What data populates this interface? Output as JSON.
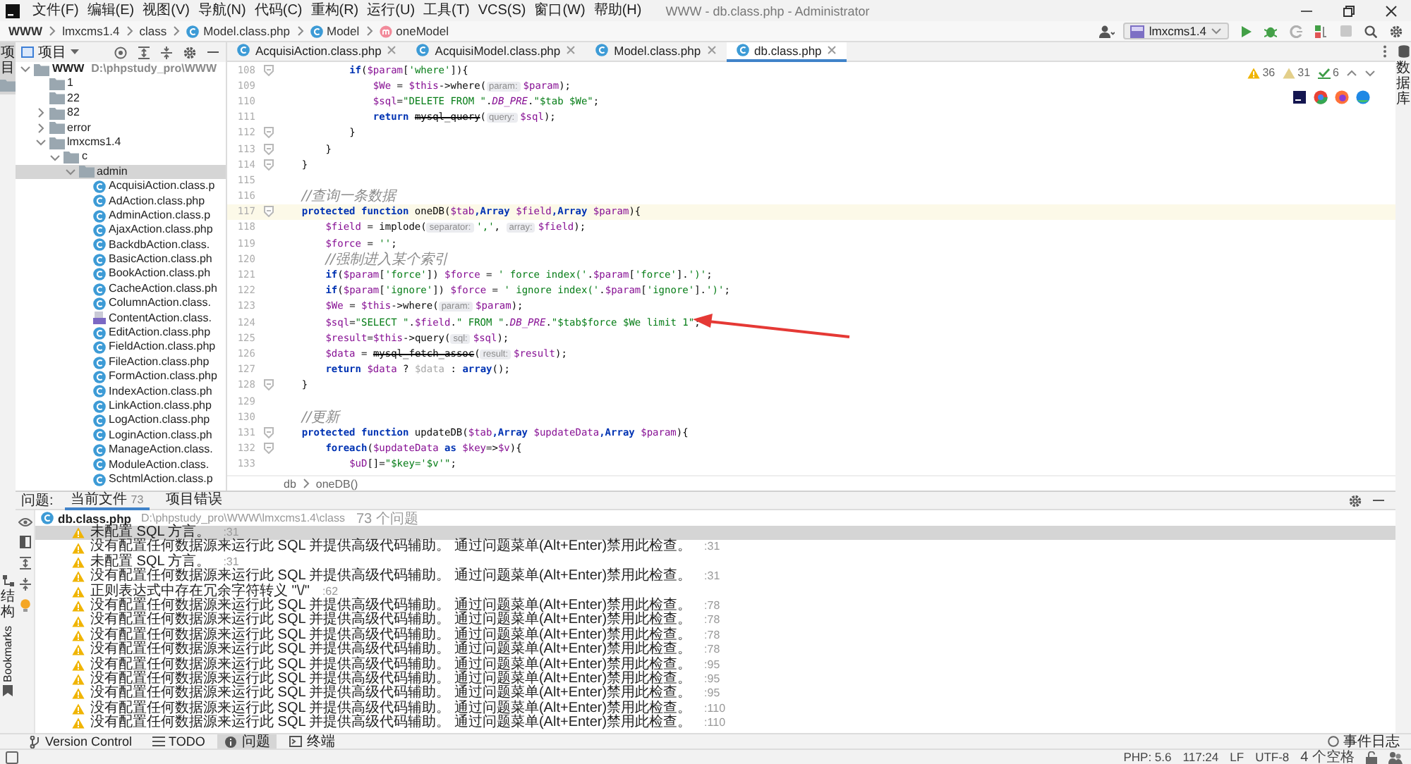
{
  "window": {
    "title": "WWW - db.class.php - Administrator"
  },
  "menu": [
    "文件(F)",
    "编辑(E)",
    "视图(V)",
    "导航(N)",
    "代码(C)",
    "重构(R)",
    "运行(U)",
    "工具(T)",
    "VCS(S)",
    "窗口(W)",
    "帮助(H)"
  ],
  "breadcrumbs": [
    {
      "kind": "project",
      "text": "WWW"
    },
    {
      "kind": "folder",
      "text": "lmxcms1.4"
    },
    {
      "kind": "folder",
      "text": "class"
    },
    {
      "kind": "class-file",
      "text": "Model.class.php"
    },
    {
      "kind": "class",
      "text": "Model"
    },
    {
      "kind": "method",
      "text": "oneModel"
    }
  ],
  "run_config": {
    "label": "lmxcms1.4"
  },
  "left_strip": {
    "top": [
      {
        "label": "项目",
        "kind": "stacked",
        "selected": true
      }
    ],
    "bottom": [
      {
        "label": "结构",
        "kind": "stacked",
        "selected": false
      },
      {
        "label": "Bookmarks",
        "kind": "rotated",
        "selected": false
      }
    ]
  },
  "right_strip": {
    "top": [
      {
        "label": "数据库",
        "kind": "stacked",
        "selected": false
      }
    ]
  },
  "project_panel": {
    "title": "项目",
    "tree": [
      {
        "label": "WWW",
        "path": "D:\\phpstudy_pro\\WWW",
        "kind": "root",
        "expanded": true,
        "selected": false,
        "children": [
          {
            "label": "1",
            "kind": "plain-folder",
            "selected": false
          },
          {
            "label": "22",
            "kind": "plain-folder",
            "selected": false
          },
          {
            "label": "82",
            "kind": "folder",
            "expanded": false,
            "selected": false
          },
          {
            "label": "error",
            "kind": "folder",
            "expanded": false,
            "selected": false
          },
          {
            "label": "lmxcms1.4",
            "kind": "folder",
            "expanded": true,
            "selected": false,
            "children": [
              {
                "label": "c",
                "kind": "folder",
                "expanded": true,
                "selected": false,
                "children": [
                  {
                    "label": "admin",
                    "kind": "folder",
                    "expanded": true,
                    "selected": true,
                    "children": [
                      {
                        "label": "AcquisiAction.class.p",
                        "kind": "class-file",
                        "selected": false
                      },
                      {
                        "label": "AdAction.class.php",
                        "kind": "class-file",
                        "selected": false
                      },
                      {
                        "label": "AdminAction.class.p",
                        "kind": "class-file",
                        "selected": false
                      },
                      {
                        "label": "AjaxAction.class.php",
                        "kind": "class-file",
                        "selected": false
                      },
                      {
                        "label": "BackdbAction.class.",
                        "kind": "class-file",
                        "selected": false
                      },
                      {
                        "label": "BasicAction.class.ph",
                        "kind": "class-file",
                        "selected": false
                      },
                      {
                        "label": "BookAction.class.ph",
                        "kind": "class-file",
                        "selected": false
                      },
                      {
                        "label": "CacheAction.class.ph",
                        "kind": "class-file",
                        "selected": false
                      },
                      {
                        "label": "ColumnAction.class.",
                        "kind": "class-file",
                        "selected": false
                      },
                      {
                        "label": "ContentAction.class.",
                        "kind": "php-file",
                        "selected": false
                      },
                      {
                        "label": "EditAction.class.php",
                        "kind": "class-file",
                        "selected": false
                      },
                      {
                        "label": "FieldAction.class.php",
                        "kind": "class-file",
                        "selected": false
                      },
                      {
                        "label": "FileAction.class.php",
                        "kind": "class-file",
                        "selected": false
                      },
                      {
                        "label": "FormAction.class.php",
                        "kind": "class-file",
                        "selected": false
                      },
                      {
                        "label": "IndexAction.class.ph",
                        "kind": "class-file",
                        "selected": false
                      },
                      {
                        "label": "LinkAction.class.php",
                        "kind": "class-file",
                        "selected": false
                      },
                      {
                        "label": "LogAction.class.php",
                        "kind": "class-file",
                        "selected": false
                      },
                      {
                        "label": "LoginAction.class.ph",
                        "kind": "class-file",
                        "selected": false
                      },
                      {
                        "label": "ManageAction.class.",
                        "kind": "class-file",
                        "selected": false
                      },
                      {
                        "label": "ModuleAction.class.",
                        "kind": "class-file",
                        "selected": false
                      },
                      {
                        "label": "SchtmlAction.class.p",
                        "kind": "class-file",
                        "selected": false
                      }
                    ]
                  }
                ]
              }
            ]
          }
        ]
      }
    ]
  },
  "editor": {
    "tabs": [
      {
        "label": "AcquisiAction.class.php",
        "selected": false
      },
      {
        "label": "AcquisiModel.class.php",
        "selected": false
      },
      {
        "label": "Model.class.php",
        "selected": false
      },
      {
        "label": "db.class.php",
        "selected": true
      }
    ],
    "inspections": [
      {
        "kind": "warning",
        "count": "36"
      },
      {
        "kind": "weak-warning",
        "count": "31"
      },
      {
        "kind": "check",
        "count": "6"
      }
    ],
    "lines": [
      {
        "number": "108",
        "fold": true,
        "current": false,
        "tokens": [
          {
            "kind": "keyword",
            "text": "if"
          },
          {
            "kind": "plain",
            "text": "("
          },
          {
            "kind": "var",
            "text": "$param"
          },
          {
            "kind": "plain",
            "text": "["
          },
          {
            "kind": "string",
            "text": "'where'"
          },
          {
            "kind": "plain",
            "text": "]){"
          }
        ]
      },
      {
        "number": "109",
        "fold": false,
        "current": false,
        "tokens": [
          {
            "kind": "var",
            "text": "$We"
          },
          {
            "kind": "plain",
            "text": " = "
          },
          {
            "kind": "var",
            "text": "$this"
          },
          {
            "kind": "plain",
            "text": "->where("
          },
          {
            "kind": "hint",
            "text": "param:"
          },
          {
            "kind": "var",
            "text": "$param"
          },
          {
            "kind": "plain",
            "text": ");"
          }
        ]
      },
      {
        "number": "110",
        "fold": false,
        "current": false,
        "tokens": [
          {
            "kind": "var",
            "text": "$sql"
          },
          {
            "kind": "plain",
            "text": "="
          },
          {
            "kind": "string",
            "text": "\"DELETE FROM \""
          },
          {
            "kind": "plain",
            "text": "."
          },
          {
            "kind": "const",
            "text": "DB_PRE"
          },
          {
            "kind": "plain",
            "text": "."
          },
          {
            "kind": "string",
            "text": "\"$tab $We\""
          },
          {
            "kind": "plain",
            "text": ";"
          }
        ]
      },
      {
        "number": "111",
        "fold": false,
        "current": false,
        "tokens": [
          {
            "kind": "keyword",
            "text": "return "
          },
          {
            "kind": "deprecated",
            "text": "mysql_query"
          },
          {
            "kind": "plain",
            "text": "("
          },
          {
            "kind": "hint",
            "text": "query:"
          },
          {
            "kind": "var",
            "text": "$sql"
          },
          {
            "kind": "plain",
            "text": ");"
          }
        ]
      },
      {
        "number": "112",
        "fold": true,
        "current": false,
        "tokens": [
          {
            "kind": "plain",
            "text": "}"
          }
        ]
      },
      {
        "number": "113",
        "fold": true,
        "current": false,
        "tokens": [
          {
            "kind": "plain",
            "text": "}"
          }
        ]
      },
      {
        "number": "114",
        "fold": true,
        "current": false,
        "tokens": [
          {
            "kind": "plain",
            "text": "}"
          }
        ]
      },
      {
        "number": "115",
        "fold": false,
        "current": false
      },
      {
        "number": "116",
        "fold": false,
        "current": false,
        "tokens": [
          {
            "kind": "comment",
            "text": "//查询一条数据"
          }
        ]
      },
      {
        "number": "117",
        "fold": true,
        "current": true,
        "tokens": [
          {
            "kind": "keyword",
            "text": "protected function "
          },
          {
            "kind": "plain",
            "text": "oneDB("
          },
          {
            "kind": "var",
            "text": "$tab"
          },
          {
            "kind": "keyword",
            "text": ",Array "
          },
          {
            "kind": "var",
            "text": "$field"
          },
          {
            "kind": "keyword",
            "text": ",Array "
          },
          {
            "kind": "var",
            "text": "$param"
          },
          {
            "kind": "plain",
            "text": "){"
          }
        ]
      },
      {
        "number": "118",
        "fold": false,
        "current": false,
        "tokens": [
          {
            "kind": "var",
            "text": "$field"
          },
          {
            "kind": "plain",
            "text": " = implode("
          },
          {
            "kind": "hint",
            "text": "separator:"
          },
          {
            "kind": "string",
            "text": "','"
          },
          {
            "kind": "plain",
            "text": ", "
          },
          {
            "kind": "hint",
            "text": "array:"
          },
          {
            "kind": "var",
            "text": "$field"
          },
          {
            "kind": "plain",
            "text": ");"
          }
        ]
      },
      {
        "number": "119",
        "fold": false,
        "current": false,
        "tokens": [
          {
            "kind": "var",
            "text": "$force"
          },
          {
            "kind": "plain",
            "text": " = "
          },
          {
            "kind": "string",
            "text": "''"
          },
          {
            "kind": "plain",
            "text": ";"
          }
        ]
      },
      {
        "number": "120",
        "fold": false,
        "current": false,
        "tokens": [
          {
            "kind": "comment",
            "text": "//强制进入某个索引"
          }
        ]
      },
      {
        "number": "121",
        "fold": false,
        "current": false,
        "tokens": [
          {
            "kind": "keyword",
            "text": "if"
          },
          {
            "kind": "plain",
            "text": "("
          },
          {
            "kind": "var",
            "text": "$param"
          },
          {
            "kind": "plain",
            "text": "["
          },
          {
            "kind": "string",
            "text": "'force'"
          },
          {
            "kind": "plain",
            "text": "]) "
          },
          {
            "kind": "var",
            "text": "$force"
          },
          {
            "kind": "plain",
            "text": " = "
          },
          {
            "kind": "string",
            "text": "' force index('"
          },
          {
            "kind": "plain",
            "text": "."
          },
          {
            "kind": "var",
            "text": "$param"
          },
          {
            "kind": "plain",
            "text": "["
          },
          {
            "kind": "string",
            "text": "'force'"
          },
          {
            "kind": "plain",
            "text": "]."
          },
          {
            "kind": "string",
            "text": "')'"
          },
          {
            "kind": "plain",
            "text": ";"
          }
        ]
      },
      {
        "number": "122",
        "fold": false,
        "current": false,
        "tokens": [
          {
            "kind": "keyword",
            "text": "if"
          },
          {
            "kind": "plain",
            "text": "("
          },
          {
            "kind": "var",
            "text": "$param"
          },
          {
            "kind": "plain",
            "text": "["
          },
          {
            "kind": "string",
            "text": "'ignore'"
          },
          {
            "kind": "plain",
            "text": "]) "
          },
          {
            "kind": "var",
            "text": "$force"
          },
          {
            "kind": "plain",
            "text": " = "
          },
          {
            "kind": "string",
            "text": "' ignore index('"
          },
          {
            "kind": "plain",
            "text": "."
          },
          {
            "kind": "var",
            "text": "$param"
          },
          {
            "kind": "plain",
            "text": "["
          },
          {
            "kind": "string",
            "text": "'ignore'"
          },
          {
            "kind": "plain",
            "text": "]."
          },
          {
            "kind": "string",
            "text": "')'"
          },
          {
            "kind": "plain",
            "text": ";"
          }
        ]
      },
      {
        "number": "123",
        "fold": false,
        "current": false,
        "tokens": [
          {
            "kind": "var",
            "text": "$We"
          },
          {
            "kind": "plain",
            "text": " = "
          },
          {
            "kind": "var",
            "text": "$this"
          },
          {
            "kind": "plain",
            "text": "->where("
          },
          {
            "kind": "hint",
            "text": "param:"
          },
          {
            "kind": "var",
            "text": "$param"
          },
          {
            "kind": "plain",
            "text": ");"
          }
        ]
      },
      {
        "number": "124",
        "fold": false,
        "current": false,
        "tokens": [
          {
            "kind": "var",
            "text": "$sql"
          },
          {
            "kind": "plain",
            "text": "="
          },
          {
            "kind": "string",
            "text": "\"SELECT \""
          },
          {
            "kind": "plain",
            "text": "."
          },
          {
            "kind": "var",
            "text": "$field"
          },
          {
            "kind": "plain",
            "text": "."
          },
          {
            "kind": "string",
            "text": "\" FROM \""
          },
          {
            "kind": "plain",
            "text": "."
          },
          {
            "kind": "const",
            "text": "DB_PRE"
          },
          {
            "kind": "plain",
            "text": "."
          },
          {
            "kind": "string",
            "text": "\"$tab$force $We limit 1\""
          },
          {
            "kind": "plain",
            "text": ";"
          }
        ]
      },
      {
        "number": "125",
        "fold": false,
        "current": false,
        "tokens": [
          {
            "kind": "var",
            "text": "$result"
          },
          {
            "kind": "plain",
            "text": "="
          },
          {
            "kind": "var",
            "text": "$this"
          },
          {
            "kind": "plain",
            "text": "->query("
          },
          {
            "kind": "hint",
            "text": "sql:"
          },
          {
            "kind": "var",
            "text": "$sql"
          },
          {
            "kind": "plain",
            "text": ");"
          }
        ]
      },
      {
        "number": "126",
        "fold": false,
        "current": false,
        "tokens": [
          {
            "kind": "var",
            "text": "$data"
          },
          {
            "kind": "plain",
            "text": " = "
          },
          {
            "kind": "deprecated",
            "text": "mysql_fetch_assoc"
          },
          {
            "kind": "plain",
            "text": "("
          },
          {
            "kind": "hint",
            "text": "result:"
          },
          {
            "kind": "var",
            "text": "$result"
          },
          {
            "kind": "plain",
            "text": ");"
          }
        ]
      },
      {
        "number": "127",
        "fold": false,
        "current": false,
        "tokens": [
          {
            "kind": "keyword",
            "text": "return "
          },
          {
            "kind": "var",
            "text": "$data"
          },
          {
            "kind": "plain",
            "text": " ? "
          },
          {
            "kind": "dim",
            "text": "$data"
          },
          {
            "kind": "plain",
            "text": " : "
          },
          {
            "kind": "keyword",
            "text": "array"
          },
          {
            "kind": "plain",
            "text": "();"
          }
        ]
      },
      {
        "number": "128",
        "fold": true,
        "current": false,
        "tokens": [
          {
            "kind": "plain",
            "text": "}"
          }
        ]
      },
      {
        "number": "129",
        "fold": false,
        "current": false
      },
      {
        "number": "130",
        "fold": false,
        "current": false,
        "tokens": [
          {
            "kind": "comment",
            "text": "//更新"
          }
        ]
      },
      {
        "number": "131",
        "fold": true,
        "current": false,
        "tokens": [
          {
            "kind": "keyword",
            "text": "protected function "
          },
          {
            "kind": "plain",
            "text": "updateDB("
          },
          {
            "kind": "var",
            "text": "$tab"
          },
          {
            "kind": "keyword",
            "text": ",Array "
          },
          {
            "kind": "var",
            "text": "$updateData"
          },
          {
            "kind": "keyword",
            "text": ",Array "
          },
          {
            "kind": "var",
            "text": "$param"
          },
          {
            "kind": "plain",
            "text": "){"
          }
        ]
      },
      {
        "number": "132",
        "fold": true,
        "current": false,
        "tokens": [
          {
            "kind": "keyword",
            "text": "foreach"
          },
          {
            "kind": "plain",
            "text": "("
          },
          {
            "kind": "var",
            "text": "$updateData"
          },
          {
            "kind": "keyword",
            "text": " as "
          },
          {
            "kind": "var",
            "text": "$key"
          },
          {
            "kind": "plain",
            "text": "=>"
          },
          {
            "kind": "var",
            "text": "$v"
          },
          {
            "kind": "plain",
            "text": "){"
          }
        ]
      },
      {
        "number": "133",
        "fold": false,
        "current": false,
        "tokens": [
          {
            "kind": "var",
            "text": "$uD"
          },
          {
            "kind": "plain",
            "text": "[]="
          },
          {
            "kind": "string",
            "text": "\"$key='$v'\""
          },
          {
            "kind": "plain",
            "text": ";"
          }
        ]
      }
    ],
    "breadcrumb": [
      "db",
      "oneDB()"
    ]
  },
  "problems": {
    "title": "问题:",
    "tabs": [
      {
        "label": "当前文件",
        "count": "73",
        "selected": true
      },
      {
        "label": "项目错误",
        "selected": false
      }
    ],
    "file": {
      "name": "db.class.php",
      "path": "D:\\phpstudy_pro\\WWW\\lmxcms1.4\\class",
      "count": "73 个问题"
    },
    "items": [
      {
        "message": "未配置 SQL 方言。",
        "line": ":31",
        "selected": true
      },
      {
        "message": "没有配置任何数据源来运行此 SQL 并提供高级代码辅助。 通过问题菜单(Alt+Enter)禁用此检查。",
        "line": ":31",
        "selected": false
      },
      {
        "message": "未配置 SQL 方言。",
        "line": ":31",
        "selected": false
      },
      {
        "message": "没有配置任何数据源来运行此 SQL 并提供高级代码辅助。 通过问题菜单(Alt+Enter)禁用此检查。",
        "line": ":31",
        "selected": false
      },
      {
        "message": "正则表达式中存在冗余字符转义 \"\\/\"",
        "line": ":62",
        "selected": false
      },
      {
        "message": "没有配置任何数据源来运行此 SQL 并提供高级代码辅助。 通过问题菜单(Alt+Enter)禁用此检查。",
        "line": ":78",
        "selected": false
      },
      {
        "message": "没有配置任何数据源来运行此 SQL 并提供高级代码辅助。 通过问题菜单(Alt+Enter)禁用此检查。",
        "line": ":78",
        "selected": false
      },
      {
        "message": "没有配置任何数据源来运行此 SQL 并提供高级代码辅助。 通过问题菜单(Alt+Enter)禁用此检查。",
        "line": ":78",
        "selected": false
      },
      {
        "message": "没有配置任何数据源来运行此 SQL 并提供高级代码辅助。 通过问题菜单(Alt+Enter)禁用此检查。",
        "line": ":78",
        "selected": false
      },
      {
        "message": "没有配置任何数据源来运行此 SQL 并提供高级代码辅助。 通过问题菜单(Alt+Enter)禁用此检查。",
        "line": ":95",
        "selected": false
      },
      {
        "message": "没有配置任何数据源来运行此 SQL 并提供高级代码辅助。 通过问题菜单(Alt+Enter)禁用此检查。",
        "line": ":95",
        "selected": false
      },
      {
        "message": "没有配置任何数据源来运行此 SQL 并提供高级代码辅助。 通过问题菜单(Alt+Enter)禁用此检查。",
        "line": ":95",
        "selected": false
      },
      {
        "message": "没有配置任何数据源来运行此 SQL 并提供高级代码辅助。 通过问题菜单(Alt+Enter)禁用此检查。",
        "line": ":110",
        "selected": false
      },
      {
        "message": "没有配置任何数据源来运行此 SQL 并提供高级代码辅助。 通过问题菜单(Alt+Enter)禁用此检查。",
        "line": ":110",
        "selected": false
      }
    ]
  },
  "tool_windows": [
    {
      "kind": "vcs",
      "label": "Version Control",
      "selected": false
    },
    {
      "kind": "todo",
      "label": "TODO",
      "selected": false
    },
    {
      "kind": "problems",
      "label": "问题",
      "selected": true
    },
    {
      "kind": "terminal",
      "label": "终端",
      "selected": false
    }
  ],
  "event_log": "事件日志",
  "status_bar": [
    "PHP: 5.6",
    "117:24",
    "LF",
    "UTF-8",
    "4 个空格"
  ]
}
